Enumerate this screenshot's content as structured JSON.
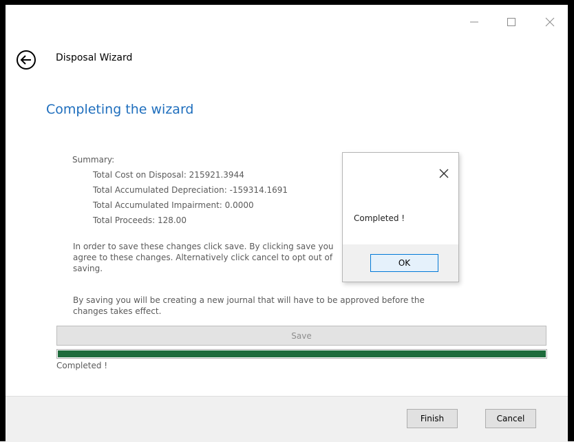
{
  "wizard": {
    "title": "Disposal Wizard",
    "heading": "Completing the wizard"
  },
  "summary": {
    "label": "Summary:",
    "items": [
      "Total Cost on Disposal: 215921.3944",
      "Total Accumulated Depreciation: -159314.1691",
      "Total Accumulated Impairment: 0.0000",
      "Total Proceeds: 128.00"
    ]
  },
  "text": {
    "paragraph1": "In order to save these changes click save. By clicking save you agree to these changes. Alternatively click cancel to opt out of saving.",
    "paragraph2": "By saving you will be creating a new journal that will have to be approved before the changes takes effect."
  },
  "save_label": "Save",
  "progress": {
    "fraction": 1.0,
    "color": "#1e6b3c"
  },
  "status": "Completed !",
  "footer": {
    "finish_label": "Finish",
    "cancel_label": "Cancel"
  },
  "dialog": {
    "message": "Completed !",
    "ok_label": "OK"
  },
  "colors": {
    "heading": "#1e6ebd",
    "accent": "#0078d7"
  },
  "icons": [
    "minimize-icon",
    "maximize-icon",
    "close-icon",
    "back-arrow-icon",
    "dialog-close-icon"
  ]
}
